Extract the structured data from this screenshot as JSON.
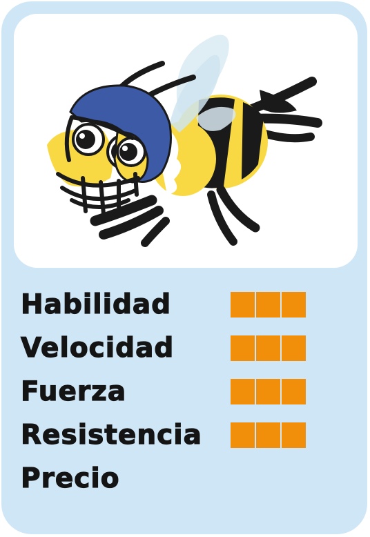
{
  "card": {
    "image": {
      "subject": "bee-with-football-helmet"
    },
    "stats": [
      {
        "label": "Habilidad",
        "level": 3,
        "max": 3
      },
      {
        "label": "Velocidad",
        "level": 3,
        "max": 3
      },
      {
        "label": "Fuerza",
        "level": 3,
        "max": 3
      },
      {
        "label": "Resistencia",
        "level": 3,
        "max": 3
      },
      {
        "label": "Precio",
        "level": 0,
        "max": 3
      }
    ],
    "colors": {
      "background": "#cfe6f6",
      "panel": "#ffffff",
      "bar": "#f18f0a",
      "text": "#141414",
      "bee_yellow": "#f9d943",
      "helmet_blue": "#3c5aa6"
    }
  }
}
